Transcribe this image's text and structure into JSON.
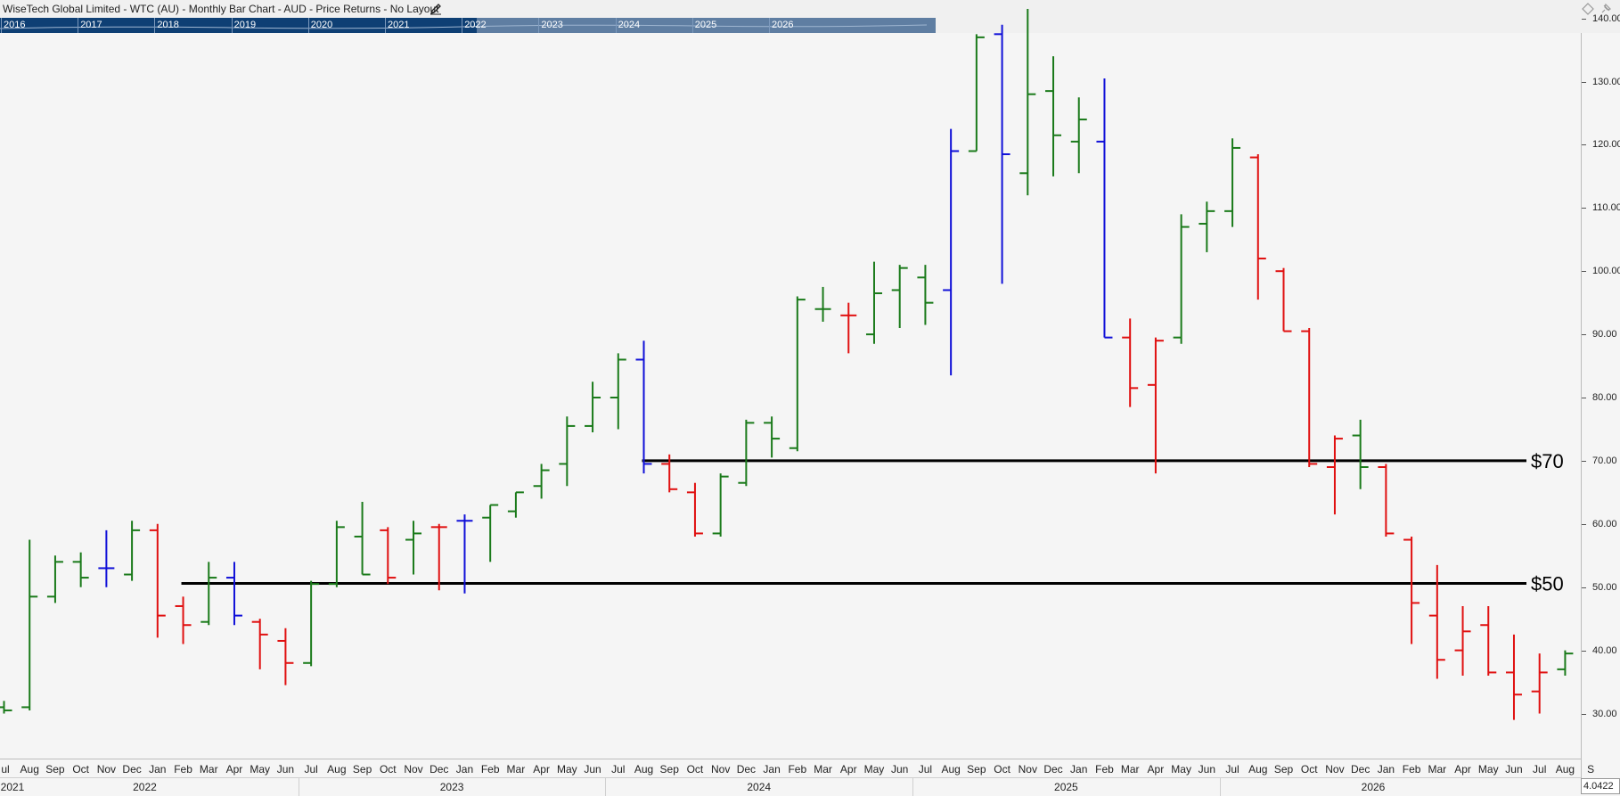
{
  "window": {
    "title": "WiseTech Global Limited - WTC (AU) - Monthly Bar Chart - AUD - Price Returns - No Layout"
  },
  "navigator": {
    "years": [
      "2016",
      "2017",
      "2018",
      "2019",
      "2020",
      "2021",
      "2022",
      "2023",
      "2024",
      "2025",
      "2026"
    ]
  },
  "colors": {
    "up": "#1a7a1a",
    "down": "#e01010",
    "neutral": "#1010d8",
    "hline": "#000000"
  },
  "last_price_label": "4.0422",
  "chart_data": {
    "type": "ohlc-bar",
    "ylim": [
      27.5,
      141.5
    ],
    "yticks": [
      "30.00",
      "40.00",
      "50.00",
      "60.00",
      "70.00",
      "80.00",
      "90.00",
      "100.00",
      "110.00",
      "120.00",
      "130.00",
      "140.00"
    ],
    "year_labels": [
      {
        "label": "2021",
        "month_index": -0.5
      },
      {
        "label": "2022",
        "month_index": 5.5
      },
      {
        "label": "2023",
        "month_index": 17.5
      },
      {
        "label": "2024",
        "month_index": 29.5
      },
      {
        "label": "2025",
        "month_index": 41.5
      },
      {
        "label": "2026",
        "month_index": 53.5
      }
    ],
    "month_labels": [
      "ul",
      "Aug",
      "Sep",
      "Oct",
      "Nov",
      "Dec",
      "Jan",
      "Feb",
      "Mar",
      "Apr",
      "May",
      "Jun",
      "Jul",
      "Aug",
      "Sep",
      "Oct",
      "Nov",
      "Dec",
      "Jan",
      "Feb",
      "Mar",
      "Apr",
      "May",
      "Jun",
      "Jul",
      "Aug",
      "Sep",
      "Oct",
      "Nov",
      "Dec",
      "Jan",
      "Feb",
      "Mar",
      "Apr",
      "May",
      "Jun",
      "Jul",
      "Aug",
      "Sep",
      "Oct",
      "Nov",
      "Dec",
      "Jan",
      "Feb",
      "Mar",
      "Apr",
      "May",
      "Jun",
      "Jul",
      "Aug",
      "Sep",
      "Oct",
      "Nov",
      "Dec",
      "Jan",
      "Feb",
      "Mar",
      "Apr",
      "May",
      "Jun",
      "Jul",
      "Aug",
      "S"
    ],
    "bars": [
      {
        "o": 31.0,
        "h": 32.0,
        "l": 30.0,
        "c": 30.5,
        "color": "up"
      },
      {
        "o": 31.0,
        "h": 57.5,
        "l": 30.5,
        "c": 48.5,
        "color": "up"
      },
      {
        "o": 48.5,
        "h": 55.0,
        "l": 47.5,
        "c": 54.0,
        "color": "up"
      },
      {
        "o": 54.0,
        "h": 55.5,
        "l": 50.0,
        "c": 51.5,
        "color": "up"
      },
      {
        "o": 53.0,
        "h": 59.0,
        "l": 50.0,
        "c": 53.0,
        "color": "neutral"
      },
      {
        "o": 52.0,
        "h": 60.5,
        "l": 51.0,
        "c": 59.0,
        "color": "up"
      },
      {
        "o": 59.0,
        "h": 60.0,
        "l": 42.0,
        "c": 45.5,
        "color": "down"
      },
      {
        "o": 47.0,
        "h": 48.5,
        "l": 41.0,
        "c": 44.0,
        "color": "down"
      },
      {
        "o": 44.5,
        "h": 54.0,
        "l": 44.0,
        "c": 51.5,
        "color": "up"
      },
      {
        "o": 51.5,
        "h": 54.0,
        "l": 44.0,
        "c": 45.5,
        "color": "neutral"
      },
      {
        "o": 44.5,
        "h": 45.0,
        "l": 37.0,
        "c": 42.5,
        "color": "down"
      },
      {
        "o": 41.5,
        "h": 43.5,
        "l": 34.5,
        "c": 38.0,
        "color": "down"
      },
      {
        "o": 38.0,
        "h": 51.0,
        "l": 37.5,
        "c": 50.5,
        "color": "up"
      },
      {
        "o": 50.5,
        "h": 60.5,
        "l": 50.0,
        "c": 59.5,
        "color": "up"
      },
      {
        "o": 58.0,
        "h": 63.5,
        "l": 52.0,
        "c": 52.0,
        "color": "up"
      },
      {
        "o": 59.0,
        "h": 59.5,
        "l": 50.5,
        "c": 51.5,
        "color": "down"
      },
      {
        "o": 57.5,
        "h": 60.5,
        "l": 52.0,
        "c": 58.5,
        "color": "up"
      },
      {
        "o": 59.5,
        "h": 60.0,
        "l": 49.5,
        "c": 59.5,
        "color": "down"
      },
      {
        "o": 60.5,
        "h": 61.5,
        "l": 49.0,
        "c": 60.5,
        "color": "neutral"
      },
      {
        "o": 61.0,
        "h": 63.0,
        "l": 54.0,
        "c": 63.0,
        "color": "up"
      },
      {
        "o": 62.0,
        "h": 65.0,
        "l": 61.0,
        "c": 65.0,
        "color": "up"
      },
      {
        "o": 66.0,
        "h": 69.5,
        "l": 64.0,
        "c": 68.5,
        "color": "up"
      },
      {
        "o": 69.5,
        "h": 77.0,
        "l": 66.0,
        "c": 75.5,
        "color": "up"
      },
      {
        "o": 75.5,
        "h": 82.5,
        "l": 74.5,
        "c": 80.0,
        "color": "up"
      },
      {
        "o": 80.0,
        "h": 87.0,
        "l": 75.0,
        "c": 86.0,
        "color": "up"
      },
      {
        "o": 86.0,
        "h": 89.0,
        "l": 68.0,
        "c": 69.5,
        "color": "neutral"
      },
      {
        "o": 69.5,
        "h": 71.0,
        "l": 65.0,
        "c": 65.5,
        "color": "down"
      },
      {
        "o": 65.0,
        "h": 66.5,
        "l": 58.0,
        "c": 58.5,
        "color": "down"
      },
      {
        "o": 58.5,
        "h": 68.0,
        "l": 58.0,
        "c": 67.5,
        "color": "up"
      },
      {
        "o": 66.5,
        "h": 76.5,
        "l": 66.0,
        "c": 76.0,
        "color": "up"
      },
      {
        "o": 76.0,
        "h": 77.0,
        "l": 70.5,
        "c": 73.5,
        "color": "up"
      },
      {
        "o": 72.0,
        "h": 96.0,
        "l": 71.5,
        "c": 95.5,
        "color": "up"
      },
      {
        "o": 94.0,
        "h": 97.5,
        "l": 92.0,
        "c": 94.0,
        "color": "up"
      },
      {
        "o": 93.0,
        "h": 95.0,
        "l": 87.0,
        "c": 93.0,
        "color": "down"
      },
      {
        "o": 90.0,
        "h": 101.5,
        "l": 88.5,
        "c": 96.5,
        "color": "up"
      },
      {
        "o": 97.0,
        "h": 101.0,
        "l": 91.0,
        "c": 100.5,
        "color": "up"
      },
      {
        "o": 99.0,
        "h": 101.0,
        "l": 91.5,
        "c": 95.0,
        "color": "up"
      },
      {
        "o": 97.0,
        "h": 122.5,
        "l": 83.5,
        "c": 119.0,
        "color": "neutral"
      },
      {
        "o": 119.0,
        "h": 137.5,
        "l": 119.0,
        "c": 137.0,
        "color": "up"
      },
      {
        "o": 137.5,
        "h": 139.0,
        "l": 98.0,
        "c": 118.5,
        "color": "neutral"
      },
      {
        "o": 115.5,
        "h": 141.5,
        "l": 112.0,
        "c": 128.0,
        "color": "up"
      },
      {
        "o": 128.5,
        "h": 134.0,
        "l": 115.0,
        "c": 121.5,
        "color": "up"
      },
      {
        "o": 120.5,
        "h": 127.5,
        "l": 115.5,
        "c": 124.0,
        "color": "up"
      },
      {
        "o": 120.5,
        "h": 130.5,
        "l": 89.5,
        "c": 89.5,
        "color": "neutral"
      },
      {
        "o": 89.5,
        "h": 92.5,
        "l": 78.5,
        "c": 81.5,
        "color": "down"
      },
      {
        "o": 82.0,
        "h": 89.5,
        "l": 68.0,
        "c": 89.0,
        "color": "down"
      },
      {
        "o": 89.5,
        "h": 109.0,
        "l": 88.5,
        "c": 107.0,
        "color": "up"
      },
      {
        "o": 107.5,
        "h": 111.0,
        "l": 103.0,
        "c": 109.5,
        "color": "up"
      },
      {
        "o": 109.5,
        "h": 121.0,
        "l": 107.0,
        "c": 119.5,
        "color": "up"
      },
      {
        "o": 118.0,
        "h": 118.5,
        "l": 95.5,
        "c": 102.0,
        "color": "down"
      },
      {
        "o": 100.0,
        "h": 100.5,
        "l": 90.5,
        "c": 90.5,
        "color": "down"
      },
      {
        "o": 90.5,
        "h": 91.0,
        "l": 69.0,
        "c": 69.5,
        "color": "down"
      },
      {
        "o": 69.0,
        "h": 74.0,
        "l": 61.5,
        "c": 73.5,
        "color": "down"
      },
      {
        "o": 74.0,
        "h": 76.5,
        "l": 65.5,
        "c": 69.0,
        "color": "up"
      },
      {
        "o": 69.0,
        "h": 69.5,
        "l": 58.0,
        "c": 58.5,
        "color": "down"
      },
      {
        "o": 57.5,
        "h": 58.0,
        "l": 41.0,
        "c": 47.5,
        "color": "down"
      },
      {
        "o": 45.5,
        "h": 53.5,
        "l": 35.5,
        "c": 38.5,
        "color": "down"
      },
      {
        "o": 40.0,
        "h": 47.0,
        "l": 36.0,
        "c": 43.0,
        "color": "down"
      },
      {
        "o": 44.0,
        "h": 47.0,
        "l": 36.0,
        "c": 36.5,
        "color": "down"
      },
      {
        "o": 36.5,
        "h": 42.5,
        "l": 29.0,
        "c": 33.0,
        "color": "down"
      },
      {
        "o": 33.5,
        "h": 39.5,
        "l": 30.0,
        "c": 36.5,
        "color": "down"
      },
      {
        "o": 37.0,
        "h": 40.0,
        "l": 36.0,
        "c": 39.5,
        "color": "up"
      }
    ],
    "hlines": [
      {
        "value": 70,
        "label": "$70",
        "from_index": 25
      },
      {
        "value": 50.6,
        "label": "$50",
        "from_index": 7
      }
    ]
  }
}
